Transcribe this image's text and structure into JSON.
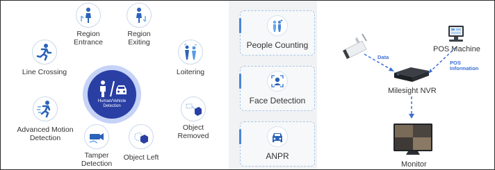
{
  "features": {
    "line_crossing": "Line Crossing",
    "region_entrance": "Region\nEntrance",
    "region_exiting": "Region\nExiting",
    "loitering": "Loitering",
    "advanced_motion": "Advanced Motion\nDetection",
    "tamper": "Tamper\nDetection",
    "object_left": "Object Left",
    "object_removed": "Object Removed",
    "center": "Human/Vehicle\nDetection"
  },
  "analytics": [
    "People Counting",
    "Face Detection",
    "ANPR"
  ],
  "topology": {
    "pos_machine": "POS Machine",
    "nvr": "Milesight NVR",
    "monitor": "Monitor",
    "data_label": "Data",
    "pos_info_label": "POS\nInformation"
  },
  "colors": {
    "accent_blue": "#2a3fa4",
    "light_blue": "#4a86d6",
    "arrow_blue": "#3b6fd6"
  }
}
